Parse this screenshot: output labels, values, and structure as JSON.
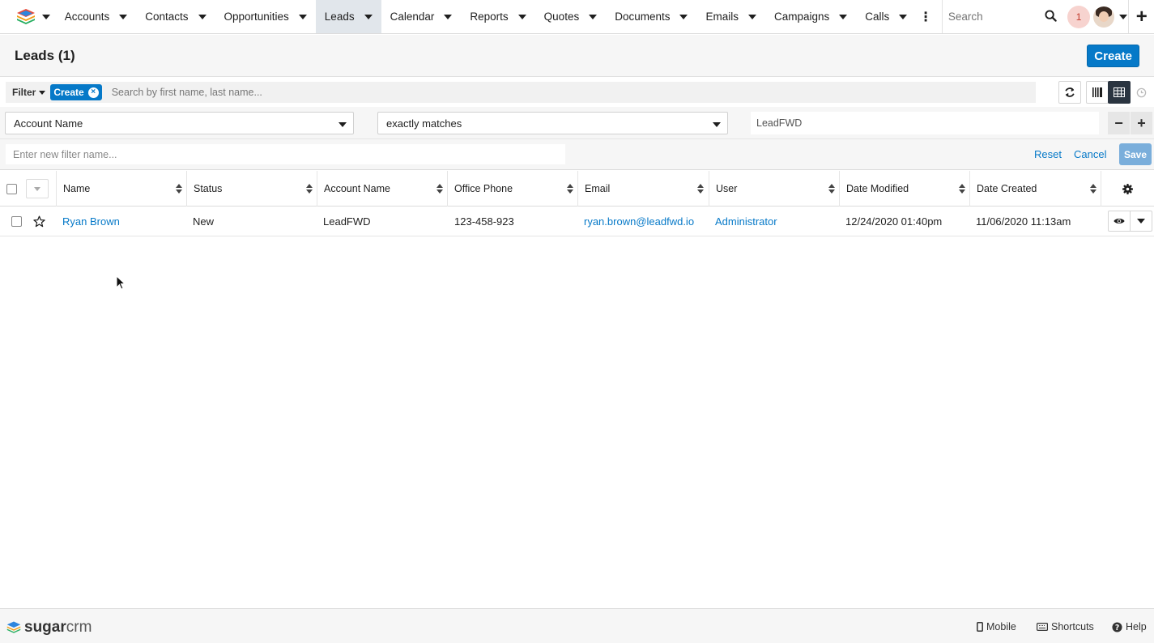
{
  "nav": {
    "items": [
      {
        "label": "Accounts"
      },
      {
        "label": "Contacts"
      },
      {
        "label": "Opportunities"
      },
      {
        "label": "Leads",
        "active": true
      },
      {
        "label": "Calendar"
      },
      {
        "label": "Reports"
      },
      {
        "label": "Quotes"
      },
      {
        "label": "Documents"
      },
      {
        "label": "Emails"
      },
      {
        "label": "Campaigns"
      },
      {
        "label": "Calls"
      }
    ],
    "search_placeholder": "Search",
    "notification_count": "1"
  },
  "header": {
    "title": "Leads (1)",
    "create_label": "Create"
  },
  "filter": {
    "dropdown_label": "Filter",
    "pill_label": "Create",
    "search_placeholder": "Search by first name, last name...",
    "field_select": "Account Name",
    "operator_select": "exactly matches",
    "value": "LeadFWD",
    "name_placeholder": "Enter new filter name...",
    "reset_label": "Reset",
    "cancel_label": "Cancel",
    "save_label": "Save"
  },
  "table": {
    "columns": [
      "Name",
      "Status",
      "Account Name",
      "Office Phone",
      "Email",
      "User",
      "Date Modified",
      "Date Created"
    ],
    "rows": [
      {
        "name": "Ryan Brown",
        "status": "New",
        "account_name": "LeadFWD",
        "office_phone": "123-458-923",
        "email": "ryan.brown@leadfwd.io",
        "user": "Administrator",
        "date_modified": "12/24/2020 01:40pm",
        "date_created": "11/06/2020 11:13am"
      }
    ]
  },
  "footer": {
    "brand_sugar": "sugar",
    "brand_crm": "crm",
    "mobile_label": "Mobile",
    "shortcuts_label": "Shortcuts",
    "help_label": "Help"
  },
  "colors": {
    "accent": "#0679c8",
    "active_tab": "#e1e6eb",
    "save_disabled": "#7aaedb",
    "notification_bg": "#f7d3cf"
  }
}
